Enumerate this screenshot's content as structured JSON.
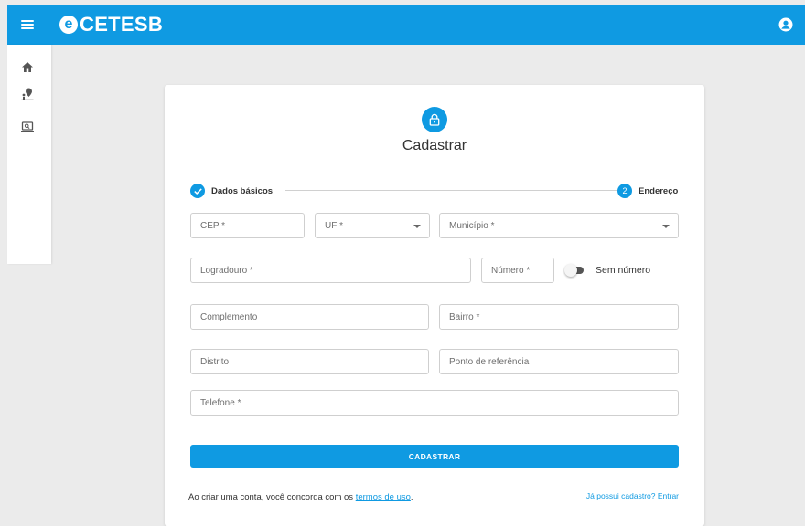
{
  "header": {
    "logo_letter": "e",
    "logo_text": "CETESB",
    "color": "#0f9ae2"
  },
  "sidebar": {
    "items": [
      {
        "icon": "home-icon"
      },
      {
        "icon": "person-location-icon"
      },
      {
        "icon": "search-screen-icon"
      }
    ]
  },
  "form": {
    "title": "Cadastrar",
    "steps": [
      {
        "label": "Dados básicos",
        "status": "completed"
      },
      {
        "number": "2",
        "label": "Endereço",
        "status": "active"
      }
    ],
    "fields": {
      "cep": "CEP *",
      "uf": "UF *",
      "municipio": "Município *",
      "logradouro": "Logradouro *",
      "numero": "Número *",
      "complemento": "Complemento",
      "bairro": "Bairro *",
      "distrito": "Distrito",
      "ponto_referencia": "Ponto de referência",
      "telefone": "Telefone *"
    },
    "sem_numero_label": "Sem número",
    "sem_numero_checked": false,
    "submit_label": "CADASTRAR",
    "terms_prefix": "Ao criar uma conta, você concorda com os ",
    "terms_link": "termos de uso",
    "terms_suffix": ".",
    "login_link": "Já possui cadastro? Entrar"
  }
}
